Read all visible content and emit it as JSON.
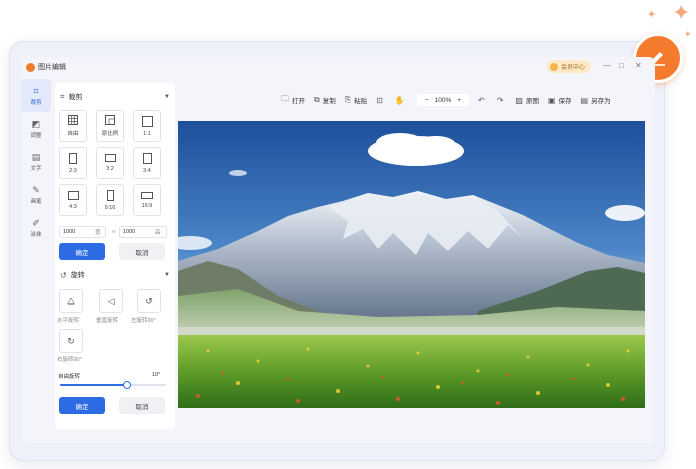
{
  "app": {
    "title": "图片编辑",
    "member_label": "会员中心"
  },
  "window_controls": {
    "minimize": "—",
    "maximize": "□",
    "close": "✕"
  },
  "rail": [
    {
      "label": "裁剪",
      "icon": "crop-icon",
      "active": true
    },
    {
      "label": "调整",
      "icon": "adjust-icon",
      "active": false
    },
    {
      "label": "文字",
      "icon": "text-icon",
      "active": false
    },
    {
      "label": "画笔",
      "icon": "brush-icon",
      "active": false
    },
    {
      "label": "涂抹",
      "icon": "smudge-icon",
      "active": false
    }
  ],
  "crop": {
    "heading": "裁剪",
    "ratios": [
      "自由",
      "原比例",
      "1:1",
      "2:3",
      "3:2",
      "3:4",
      "4:3",
      "9:16",
      "16:9"
    ],
    "width_value": "1000",
    "width_unit": "宽",
    "height_value": "1000",
    "height_unit": "高",
    "link_symbol": "∞",
    "confirm": "确定",
    "cancel": "取消"
  },
  "rotate": {
    "heading": "旋转",
    "actions": [
      "水平旋转",
      "垂直旋转",
      "左旋转90°",
      "右旋转90°"
    ],
    "free_label": "自由旋转",
    "free_value": "10°",
    "slider_fraction": 0.62,
    "confirm": "确定",
    "cancel": "取消"
  },
  "toolbar": {
    "open": "打开",
    "copy": "复制",
    "paste": "粘贴",
    "zoom_minus": "−",
    "zoom": "100%",
    "zoom_plus": "+",
    "original": "原图",
    "save": "保存",
    "save_as": "另存为"
  },
  "colors": {
    "accent": "#2d6be4",
    "brand": "#f47b2e"
  }
}
